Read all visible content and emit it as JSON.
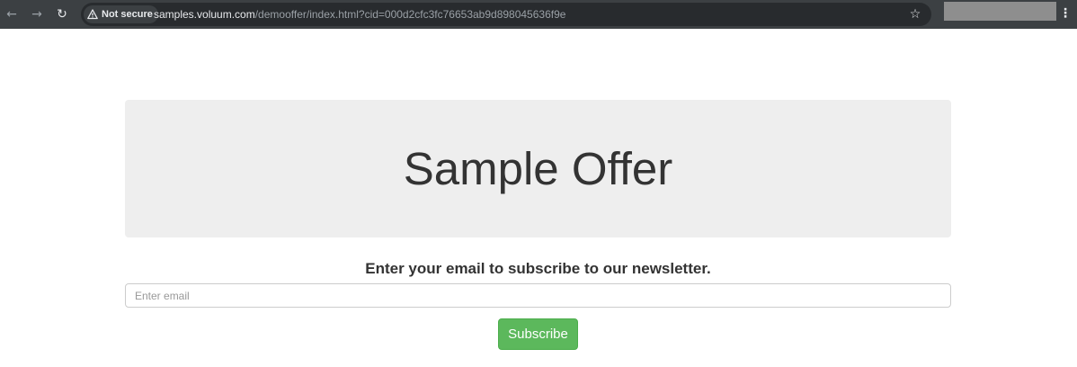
{
  "browser": {
    "security_label": "Not secure",
    "url_host": "samples.voluum.com",
    "url_path": "/demooffer/index.html?cid=000d2cfc3fc76653ab9d898045636f9e",
    "icons": {
      "back": "back-arrow-icon",
      "forward": "forward-arrow-icon",
      "reload": "reload-icon",
      "warning": "warning-icon",
      "bookmark": "star-icon",
      "menu": "kebab-menu-icon"
    }
  },
  "page": {
    "title": "Sample Offer",
    "subscribe_prompt": "Enter your email to subscribe to our newsletter.",
    "email_placeholder": "Enter email",
    "email_value": "",
    "subscribe_label": "Subscribe"
  },
  "colors": {
    "toolbar_bg": "#3c4043",
    "jumbotron_bg": "#eeeeee",
    "button_green": "#5cb85c",
    "text_dark": "#333333"
  }
}
